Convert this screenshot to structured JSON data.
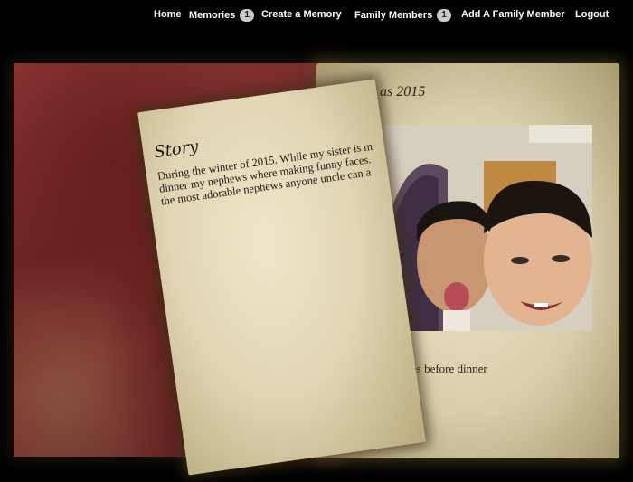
{
  "nav": {
    "home": "Home",
    "memories": "Memories",
    "memories_count": "1",
    "create_memory": "Create a Memory",
    "family_members": "Family Members",
    "family_members_count": "1",
    "add_family_member": "Add A Family Member",
    "logout": "Logout"
  },
  "memory": {
    "title_visible": "as 2015",
    "caption_visible": "es before dinner"
  },
  "story": {
    "heading": "Story",
    "lines": [
      "During the winter of 2015. While my sister is m",
      "dinner my nephews where making funny faces.",
      "the most adorable nephews anyone uncle can a"
    ]
  },
  "colors": {
    "background": "#000000",
    "nav_text": "#ffffff",
    "badge": "#c9c9c9",
    "cover": "#7c302e",
    "paper": "#e6dcba"
  }
}
